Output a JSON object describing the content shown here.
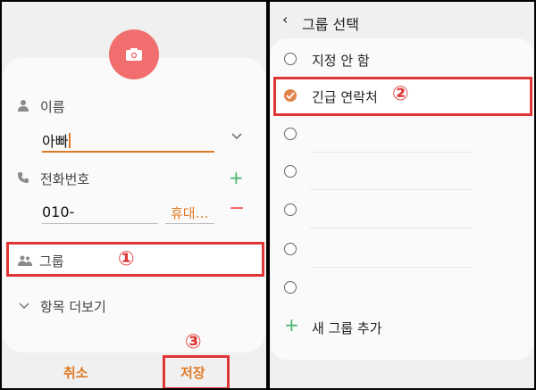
{
  "edit_contact": {
    "name_label": "이름",
    "name_value": "아빠",
    "phone_label": "전화번호",
    "phone_value": "010-",
    "phone_type": "휴대…",
    "group_label": "그룹",
    "more_fields_label": "항목 더보기",
    "cancel_label": "취소",
    "save_label": "저장"
  },
  "group_select": {
    "back_icon": "‹",
    "title": "그룹 선택",
    "options": [
      {
        "label": "지정 안 함",
        "checked": false
      },
      {
        "label": "긴급 연락처",
        "checked": true
      },
      {
        "label": "",
        "checked": false
      },
      {
        "label": "",
        "checked": false
      },
      {
        "label": "",
        "checked": false
      },
      {
        "label": "",
        "checked": false
      },
      {
        "label": "",
        "checked": false
      }
    ],
    "add_group_label": "새 그룹 추가"
  },
  "steps": [
    "①",
    "②",
    "③"
  ],
  "icons": {
    "camera": "camera-icon",
    "person": "person-icon",
    "phone": "phone-icon",
    "group": "group-icon",
    "chevron_down": "chevron-down-icon",
    "check": "check-icon"
  },
  "colors": {
    "accent": "#e07a26",
    "highlight": "#e03636",
    "camera_bg": "#f06e6e",
    "add_green": "#43b66b",
    "remove_red": "#ef5a5a"
  }
}
